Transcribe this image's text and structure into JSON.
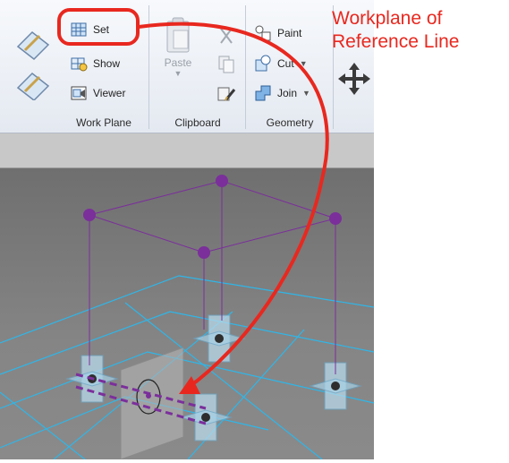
{
  "ribbon": {
    "work_plane": {
      "set_label": "Set",
      "show_label": "Show",
      "viewer_label": "Viewer",
      "title": "Work Plane"
    },
    "clipboard": {
      "paste_label": "Paste",
      "title": "Clipboard"
    },
    "geometry": {
      "paint_label": "Paint",
      "cut_label": "Cut",
      "join_label": "Join",
      "title": "Geometry"
    }
  },
  "annotation": {
    "line1": "Workplane of",
    "line2": "Reference Line",
    "color": "#e8281f"
  },
  "colors": {
    "highlight_outline": "#e8281f",
    "reference_lines": "#7b2f9b",
    "workplane_grid": "#2fb6e8",
    "viewport_bg": "#7e7e7e"
  }
}
